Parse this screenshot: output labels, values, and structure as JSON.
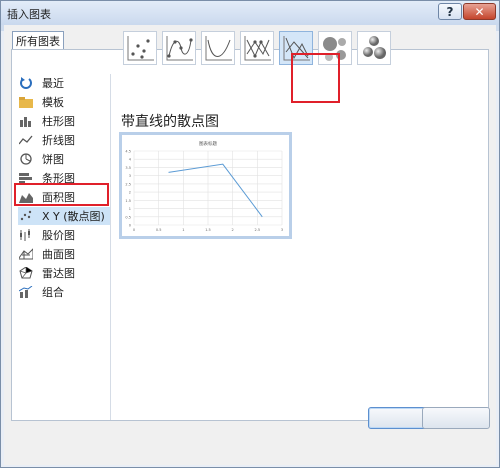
{
  "window": {
    "title": "插入图表"
  },
  "tabs": [
    {
      "label": "所有图表"
    }
  ],
  "sidebar": {
    "items": [
      {
        "label": "最近",
        "icon": "recent-icon"
      },
      {
        "label": "模板",
        "icon": "folder-icon"
      },
      {
        "label": "柱形图",
        "icon": "column-chart-icon"
      },
      {
        "label": "折线图",
        "icon": "line-chart-icon"
      },
      {
        "label": "饼图",
        "icon": "pie-chart-icon"
      },
      {
        "label": "条形图",
        "icon": "bar-chart-icon"
      },
      {
        "label": "面积图",
        "icon": "area-chart-icon"
      },
      {
        "label": "X Y (散点图)",
        "icon": "scatter-chart-icon"
      },
      {
        "label": "股价图",
        "icon": "stock-chart-icon"
      },
      {
        "label": "曲面图",
        "icon": "surface-chart-icon"
      },
      {
        "label": "雷达图",
        "icon": "radar-chart-icon"
      },
      {
        "label": "组合",
        "icon": "combo-chart-icon"
      }
    ],
    "selected_index": 7
  },
  "subtypes": [
    {
      "name": "scatter",
      "icon": "scatter-icon"
    },
    {
      "name": "scatter-smooth-markers",
      "icon": "scatter-smooth-markers-icon"
    },
    {
      "name": "scatter-smooth",
      "icon": "scatter-smooth-icon"
    },
    {
      "name": "scatter-straight-markers",
      "icon": "scatter-straight-markers-icon"
    },
    {
      "name": "scatter-straight",
      "icon": "scatter-straight-icon"
    },
    {
      "name": "bubble",
      "icon": "bubble-icon"
    },
    {
      "name": "bubble-3d",
      "icon": "bubble-3d-icon"
    }
  ],
  "selected_subtype_index": 4,
  "section_title": "带直线的散点图",
  "preview": {
    "chart_title": "图表标题",
    "y_ticks": [
      "4.5",
      "4",
      "3.5",
      "3",
      "2.5",
      "2",
      "1.5",
      "1",
      "0.5",
      "0"
    ],
    "x_ticks": [
      "0",
      "0.5",
      "1",
      "1.5",
      "2",
      "2.5",
      "3"
    ]
  },
  "chart_data": {
    "type": "scatter",
    "title": "图表标题",
    "x": [
      0.7,
      1.8,
      2.6
    ],
    "y": [
      3.2,
      3.7,
      0.5
    ],
    "xlim": [
      0,
      3
    ],
    "ylim": [
      0,
      4.5
    ],
    "line": true,
    "grid": true
  },
  "buttons": {
    "ok": "",
    "cancel": ""
  },
  "colors": {
    "accent": "#e0202a",
    "series": "#5b9bd5",
    "selection": "#cde3f7"
  }
}
